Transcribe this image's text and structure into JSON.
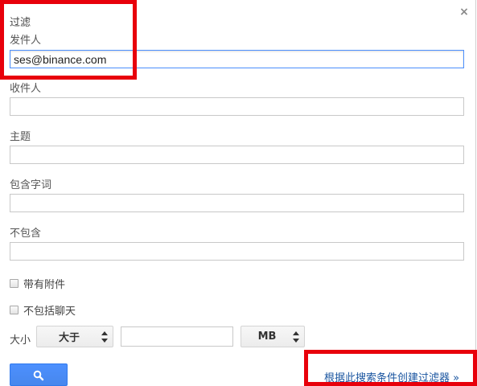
{
  "dialog": {
    "title": "过滤",
    "close_glyph": "×"
  },
  "fields": {
    "from": {
      "label": "发件人",
      "value": "ses@binance.com"
    },
    "to": {
      "label": "收件人",
      "value": ""
    },
    "subject": {
      "label": "主题",
      "value": ""
    },
    "has_words": {
      "label": "包含字词",
      "value": ""
    },
    "doesnt_have": {
      "label": "不包含",
      "value": ""
    }
  },
  "options": {
    "has_attachment": {
      "label": "带有附件",
      "checked": false
    },
    "exclude_chats": {
      "label": "不包括聊天",
      "checked": false
    }
  },
  "size": {
    "label": "大小",
    "comparator": "大于",
    "value": "",
    "unit": "MB"
  },
  "actions": {
    "search_icon": "search-icon",
    "create_filter_link": "根据此搜索条件创建过滤器 »"
  },
  "colors": {
    "accent": "#4d90fe",
    "link": "#1a55a0",
    "highlight": "#e8000b"
  }
}
